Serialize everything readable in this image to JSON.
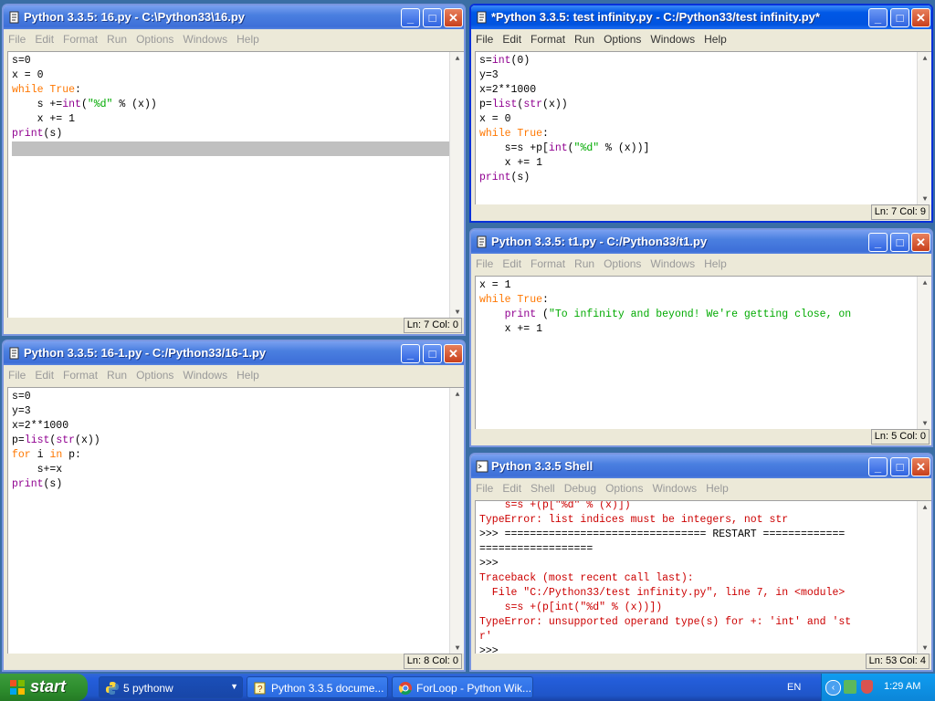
{
  "windows": {
    "w16": {
      "title": "Python 3.3.5: 16.py - C:\\Python33\\16.py",
      "menus": [
        "File",
        "Edit",
        "Format",
        "Run",
        "Options",
        "Windows",
        "Help"
      ],
      "status": "Ln: 7 Col: 0"
    },
    "wtest": {
      "title": "*Python 3.3.5: test infinity.py - C:/Python33/test infinity.py*",
      "menus": [
        "File",
        "Edit",
        "Format",
        "Run",
        "Options",
        "Windows",
        "Help"
      ],
      "status": "Ln: 7 Col: 9"
    },
    "wt1": {
      "title": "Python 3.3.5: t1.py - C:/Python33/t1.py",
      "menus": [
        "File",
        "Edit",
        "Format",
        "Run",
        "Options",
        "Windows",
        "Help"
      ],
      "status": "Ln: 5 Col: 0"
    },
    "w161": {
      "title": "Python 3.3.5: 16-1.py - C:/Python33/16-1.py",
      "menus": [
        "File",
        "Edit",
        "Format",
        "Run",
        "Options",
        "Windows",
        "Help"
      ],
      "status": "Ln: 8 Col: 0"
    },
    "wshell": {
      "title": "Python 3.3.5 Shell",
      "menus": [
        "File",
        "Edit",
        "Shell",
        "Debug",
        "Options",
        "Windows",
        "Help"
      ],
      "status": "Ln: 53 Col: 4"
    }
  },
  "code": {
    "w16": [
      [
        {
          "t": "s=0"
        }
      ],
      [
        {
          "t": "x = 0"
        }
      ],
      [
        {
          "t": "while",
          "c": "kw"
        },
        {
          "t": " "
        },
        {
          "t": "True",
          "c": "kw"
        },
        {
          "t": ":"
        }
      ],
      [
        {
          "t": "    s +="
        },
        {
          "t": "int",
          "c": "bi"
        },
        {
          "t": "("
        },
        {
          "t": "\"%d\"",
          "c": "str"
        },
        {
          "t": " % (x))"
        }
      ],
      [
        {
          "t": "    x += 1"
        }
      ],
      [
        {
          "t": "print",
          "c": "bi"
        },
        {
          "t": "(s)"
        }
      ],
      [
        {
          "t": " "
        }
      ]
    ],
    "wtest": [
      [
        {
          "t": "s="
        },
        {
          "t": "int",
          "c": "bi"
        },
        {
          "t": "(0)"
        }
      ],
      [
        {
          "t": "y=3"
        }
      ],
      [
        {
          "t": "x=2**1000"
        }
      ],
      [
        {
          "t": "p="
        },
        {
          "t": "list",
          "c": "bi"
        },
        {
          "t": "("
        },
        {
          "t": "str",
          "c": "bi"
        },
        {
          "t": "(x))"
        }
      ],
      [
        {
          "t": "x = 0"
        }
      ],
      [
        {
          "t": "while",
          "c": "kw"
        },
        {
          "t": " "
        },
        {
          "t": "True",
          "c": "kw"
        },
        {
          "t": ":"
        }
      ],
      [
        {
          "t": "    s=s +p["
        },
        {
          "t": "int",
          "c": "bi"
        },
        {
          "t": "("
        },
        {
          "t": "\"%d\"",
          "c": "str"
        },
        {
          "t": " % (x))]"
        }
      ],
      [
        {
          "t": "    x += 1"
        }
      ],
      [
        {
          "t": "print",
          "c": "bi"
        },
        {
          "t": "(s)"
        }
      ]
    ],
    "wt1": [
      [
        {
          "t": "x = 1"
        }
      ],
      [
        {
          "t": "while",
          "c": "kw"
        },
        {
          "t": " "
        },
        {
          "t": "True",
          "c": "kw"
        },
        {
          "t": ":"
        }
      ],
      [
        {
          "t": "    "
        },
        {
          "t": "print",
          "c": "bi"
        },
        {
          "t": " ("
        },
        {
          "t": "\"To infinity and beyond! We're getting close, on",
          "c": "str"
        }
      ],
      [
        {
          "t": "    x += 1"
        }
      ]
    ],
    "w161": [
      [
        {
          "t": "s=0"
        }
      ],
      [
        {
          "t": "y=3"
        }
      ],
      [
        {
          "t": "x=2**1000"
        }
      ],
      [
        {
          "t": "p="
        },
        {
          "t": "list",
          "c": "bi"
        },
        {
          "t": "("
        },
        {
          "t": "str",
          "c": "bi"
        },
        {
          "t": "(x))"
        }
      ],
      [
        {
          "t": "for",
          "c": "kw"
        },
        {
          "t": " i "
        },
        {
          "t": "in",
          "c": "kw"
        },
        {
          "t": " p:"
        }
      ],
      [
        {
          "t": "    s+=x"
        }
      ],
      [
        {
          "t": "print",
          "c": "bi"
        },
        {
          "t": "(s)"
        }
      ]
    ],
    "wshell": [
      [
        {
          "t": "    s=s +(p[\"%d\" % (x)])",
          "c": "err"
        }
      ],
      [
        {
          "t": "TypeError: list indices must be integers, not str",
          "c": "err"
        }
      ],
      [
        {
          "t": ">>> ================================ RESTART ============="
        }
      ],
      [
        {
          "t": "=================="
        }
      ],
      [
        {
          "t": ">>> "
        }
      ],
      [
        {
          "t": "Traceback (most recent call last):",
          "c": "err"
        }
      ],
      [
        {
          "t": "  File \"C:/Python33/test infinity.py\", line 7, in <module>",
          "c": "err"
        }
      ],
      [
        {
          "t": "    s=s +(p[int(\"%d\" % (x))])",
          "c": "err"
        }
      ],
      [
        {
          "t": "TypeError: unsupported operand type(s) for +: 'int' and 'st",
          "c": "err"
        }
      ],
      [
        {
          "t": "r'",
          "c": "err"
        }
      ],
      [
        {
          "t": ">>> "
        }
      ]
    ]
  },
  "taskbar": {
    "start_label": "start",
    "tasks": [
      "5 pythonw",
      "Python 3.3.5 docume...",
      "ForLoop - Python Wik..."
    ],
    "lang": "EN",
    "clock": "1:29 AM"
  },
  "colors": {
    "keyword": "#ff7700",
    "builtin": "#900090",
    "string": "#00aa00",
    "error": "#cc0000",
    "title_active": "#0058e6",
    "taskbar": "#245edb",
    "start": "#2d8c2d"
  }
}
